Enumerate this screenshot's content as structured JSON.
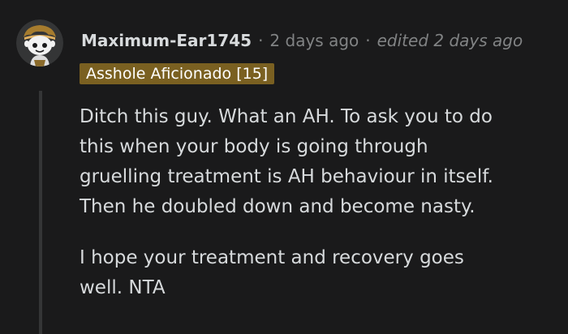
{
  "comment": {
    "username": "Maximum-Ear1745",
    "separator": "·",
    "timestamp": "2 days ago",
    "edited": "edited 2 days ago",
    "flair": "Asshole Aficionado [15]",
    "paragraphs": [
      {
        "lines": [
          "Ditch this guy. What an AH. To ask you to do",
          "this when your body is going through",
          "gruelling treatment is AH behaviour in itself.",
          "Then he doubled down and become nasty."
        ]
      },
      {
        "lines": [
          "I hope your treatment and recovery goes",
          "well. NTA"
        ]
      }
    ]
  },
  "colors": {
    "background": "#1a1a1b",
    "text": "#d7dadc",
    "meta": "#818384",
    "flair_bg": "#7a6021",
    "thread_line": "#343536"
  },
  "avatar_icon": "snoo-avatar-icon"
}
